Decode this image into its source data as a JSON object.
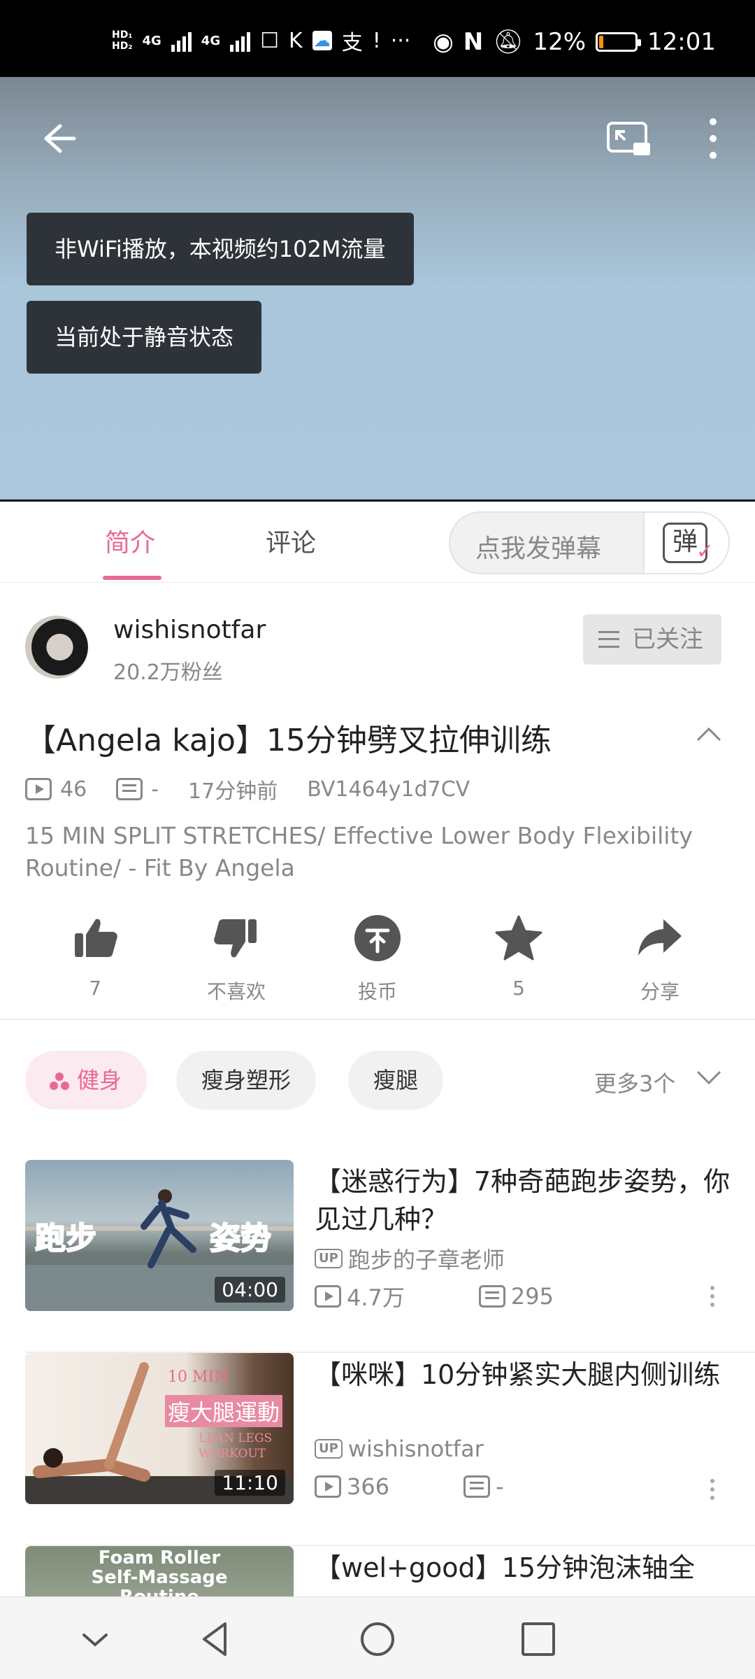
{
  "status_bar": {
    "network_1": "4G",
    "network_2": "4G",
    "battery_percent": "12%",
    "time": "12:01",
    "battery_level": 0.12
  },
  "player": {
    "toast_data": "非WiFi播放，本视频约102M流量",
    "toast_mute": "当前处于静音状态"
  },
  "tabs": {
    "intro": "简介",
    "comments": "评论",
    "danmu_placeholder": "点我发弹幕",
    "danmu_icon_char": "弹"
  },
  "uploader": {
    "name": "wishisnotfar",
    "fans": "20.2万粉丝",
    "follow_label": "已关注"
  },
  "video": {
    "title": "【Angela kajo】15分钟劈叉拉伸训练",
    "plays": "46",
    "danmaku": "-",
    "time_ago": "17分钟前",
    "bvid": "BV1464y1d7CV",
    "description": "15 MIN SPLIT STRETCHES/ Effective Lower Body Flexibility Routine/ - Fit By Angela"
  },
  "actions": {
    "like": "7",
    "dislike": "不喜欢",
    "coin": "投币",
    "favorite": "5",
    "share": "分享"
  },
  "tags": {
    "items": [
      "健身",
      "瘦身塑形",
      "瘦腿"
    ],
    "more": "更多3个"
  },
  "related": [
    {
      "title": "【迷惑行为】7种奇葩跑步姿势，你见过几种？",
      "up_badge": "UP",
      "uploader": "跑步的子章老师",
      "plays": "4.7万",
      "danmaku": "295",
      "duration": "04:00",
      "thumb_text_1": "跑步",
      "thumb_text_2": "姿势"
    },
    {
      "title": "【咪咪】10分钟紧实大腿内侧训练",
      "up_badge": "UP",
      "uploader": "wishisnotfar",
      "plays": "366",
      "danmaku": "-",
      "duration": "11:10",
      "thumb_text_1": "10 MIN",
      "thumb_text_2": "瘦大腿運動",
      "thumb_text_3": "LEAN LEGS",
      "thumb_text_4": "WORKOUT"
    },
    {
      "title": "【wel+good】15分钟泡沫轴全",
      "thumb_text_1": "Foam Roller",
      "thumb_text_2": "Self-Massage",
      "thumb_text_3": "Routine"
    }
  ],
  "colors": {
    "accent": "#e86a92",
    "statusbar": "#000000",
    "toast": "#2e3339"
  }
}
